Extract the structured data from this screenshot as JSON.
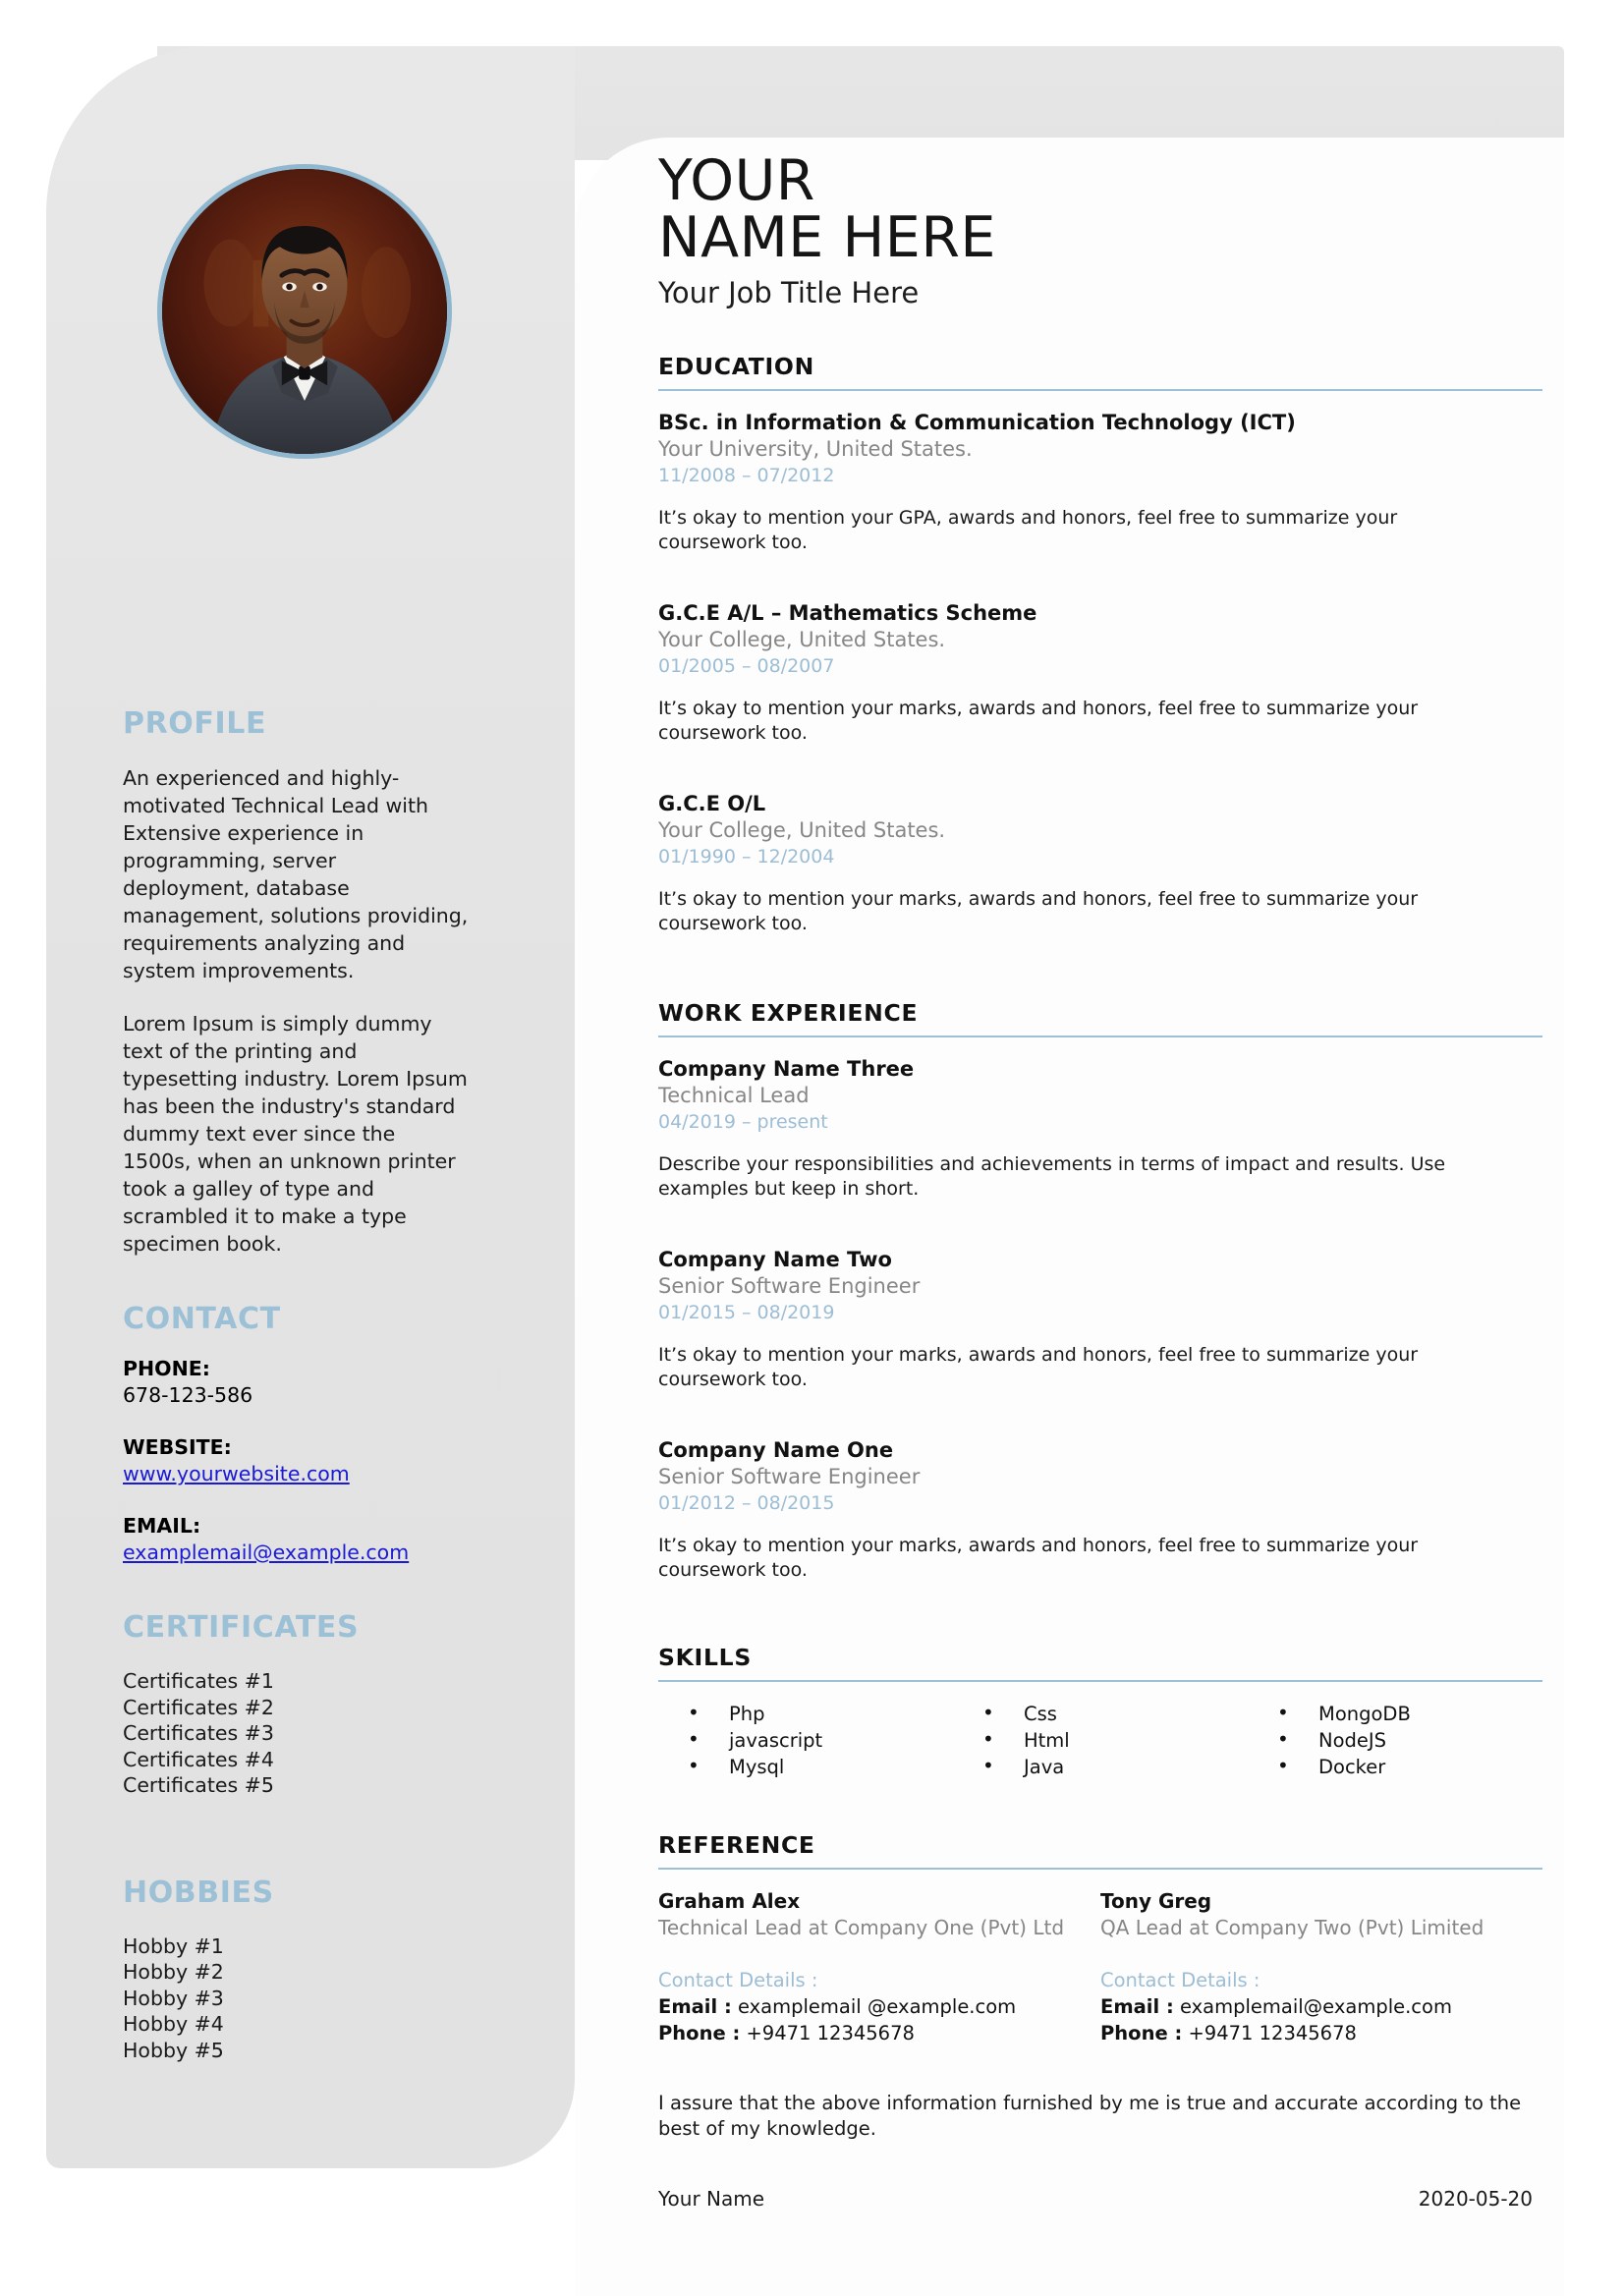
{
  "header": {
    "name_line1": "YOUR",
    "name_line2": "NAME HERE",
    "job_title": "Your Job Title Here"
  },
  "sidebar": {
    "profile": {
      "heading": "PROFILE",
      "paragraph1": "An experienced and highly-motivated Technical Lead with Extensive experience in programming, server deployment, database management, solutions providing, requirements analyzing and system improvements.",
      "paragraph2": "Lorem Ipsum is simply dummy text of the printing and typesetting industry. Lorem Ipsum has been the industry's standard dummy text ever since the 1500s, when an unknown printer took a galley of type and scrambled it to make a type specimen book."
    },
    "contact": {
      "heading": "CONTACT",
      "phone_label": "PHONE:",
      "phone_value": "678-123-586",
      "website_label": "WEBSITE:",
      "website_value": "www.yourwebsite.com",
      "email_label": "EMAIL:",
      "email_value": "examplemail@example.com"
    },
    "certificates": {
      "heading": "CERTIFICATES",
      "items": [
        "Certificates #1",
        "Certificates #2",
        "Certificates #3",
        "Certificates #4",
        "Certificates #5"
      ]
    },
    "hobbies": {
      "heading": "HOBBIES",
      "items": [
        "Hobby #1",
        "Hobby #2",
        "Hobby #3",
        "Hobby #4",
        "Hobby #5"
      ]
    }
  },
  "education": {
    "heading": "EDUCATION",
    "entries": [
      {
        "title": "BSc. in Information & Communication Technology (ICT)",
        "org": "Your University, United States.",
        "date": "11/2008 – 07/2012",
        "desc": "It’s okay to mention your GPA, awards and honors, feel free to summarize your coursework too."
      },
      {
        "title": "G.C.E A/L – Mathematics Scheme",
        "org": "Your College, United States.",
        "date": "01/2005 – 08/2007",
        "desc": "It’s okay to mention your marks, awards and honors, feel free to summarize your coursework too."
      },
      {
        "title": "G.C.E O/L",
        "org": "Your College, United States.",
        "date": "01/1990 – 12/2004",
        "desc": "It’s okay to mention your marks, awards and honors, feel free to summarize your coursework too."
      }
    ]
  },
  "work": {
    "heading": "WORK EXPERIENCE",
    "entries": [
      {
        "title": "Company Name Three",
        "org": "Technical Lead",
        "date": "04/2019 – present",
        "desc": "Describe your responsibilities and achievements in terms of impact and results. Use examples but keep in short."
      },
      {
        "title": "Company Name Two",
        "org": "Senior Software Engineer",
        "date": "01/2015 – 08/2019",
        "desc": "It’s okay to mention your marks, awards and honors, feel free to summarize your coursework too."
      },
      {
        "title": "Company Name One",
        "org": "Senior Software Engineer",
        "date": "01/2012 – 08/2015",
        "desc": "It’s okay to mention your marks, awards and honors, feel free to summarize your coursework too."
      }
    ]
  },
  "skills": {
    "heading": "SKILLS",
    "columns": [
      [
        "Php",
        "javascript",
        "Mysql"
      ],
      [
        "Css",
        "Html",
        "Java"
      ],
      [
        "MongoDB",
        "NodeJS",
        "Docker"
      ]
    ]
  },
  "reference": {
    "heading": "REFERENCE",
    "entries": [
      {
        "name": "Graham Alex",
        "role": "Technical Lead at Company One (Pvt) Ltd",
        "contact_label": "Contact Details :",
        "email_label": "Email :",
        "email_value": "examplemail @example.com",
        "phone_label": "Phone :",
        "phone_value": "+9471 12345678"
      },
      {
        "name": "Tony Greg",
        "role": "QA Lead at Company Two (Pvt) Limited",
        "contact_label": "Contact Details :",
        "email_label": "Email :",
        "email_value": "examplemail@example.com",
        "phone_label": "Phone :",
        "phone_value": "+9471 12345678"
      }
    ]
  },
  "footer": {
    "assurance": "I assure that the above information furnished by me is true and accurate according to the best of my knowledge.",
    "signer_name": "Your Name",
    "date": "2020-05-20"
  },
  "colors": {
    "accent": "#9cc0d6",
    "muted": "#868686",
    "link": "#1a1ad6",
    "sidebar_bg": "#e5e5e5"
  }
}
